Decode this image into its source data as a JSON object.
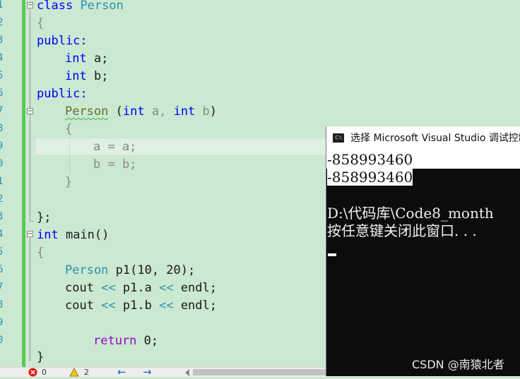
{
  "editor": {
    "line_numbers": [
      "1",
      "2",
      "3",
      "4",
      "5",
      "6",
      "7",
      "8",
      "9",
      "0",
      "1",
      "2",
      "3",
      "4",
      "5",
      "6",
      "7",
      "8",
      "9",
      "0"
    ],
    "fold_marker": "−",
    "code": {
      "l1_kw": "class",
      "l1_name": "Person",
      "l2": "{",
      "l3": "public:",
      "l4_type": "int",
      "l4_var": "a;",
      "l5_type": "int",
      "l5_var": "b;",
      "l6": "public:",
      "l7_name": "Person",
      "l7_open": " (",
      "l7_t1": "int",
      "l7_a": " a, ",
      "l7_t2": "int",
      "l7_b": " b",
      "l7_close": ")",
      "l8": "{",
      "l9": "a = a;",
      "l10": "b = b;",
      "l11": "}",
      "l13": "};",
      "l14_kw": "int",
      "l14_rest": " main()",
      "l15": "{",
      "l16_type": "Person",
      "l16_rest": " p1(10, 20);",
      "l17_a": "cout ",
      "l17_op1": "<<",
      "l17_b": " p1.a ",
      "l17_op2": "<<",
      "l17_c": " endl;",
      "l18_a": "cout ",
      "l18_op1": "<<",
      "l18_b": " p1.b ",
      "l18_op2": "<<",
      "l18_c": " endl;",
      "l20_kw": "return",
      "l20_rest": " 0;",
      "l21": "}"
    }
  },
  "status": {
    "error_icon": "error-icon",
    "error_count": "0",
    "warning_icon": "warning-icon",
    "warning_count": "2",
    "back_arrow": "←",
    "forward_arrow": "→"
  },
  "console": {
    "title": "选择 Microsoft Visual Studio 调试控制台",
    "icon_label": "C:\\",
    "line1": "-858993460",
    "line2": "-858993460",
    "line3": "D:\\代码库\\Code8_month",
    "line4": "按任意键关闭此窗口. . ."
  },
  "watermark": "CSDN @南猿北者"
}
